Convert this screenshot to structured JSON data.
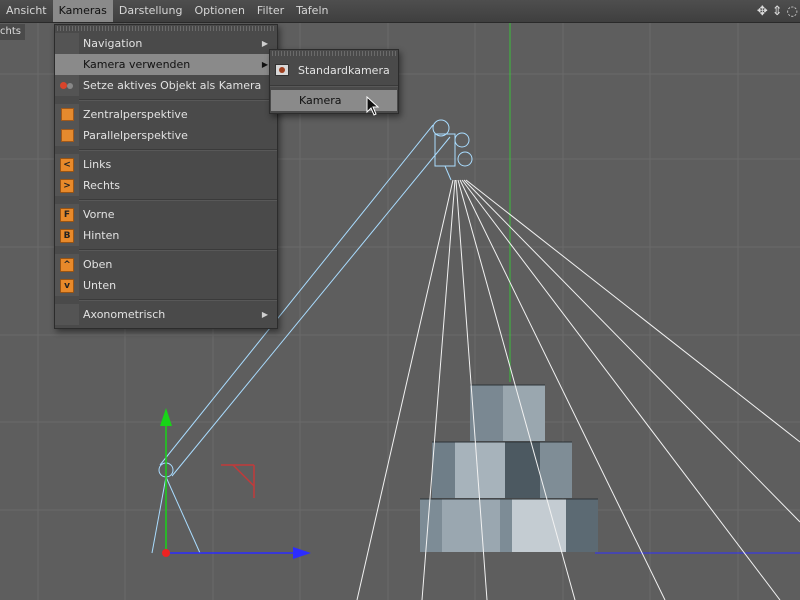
{
  "menubar": {
    "items": [
      "Ansicht",
      "Kameras",
      "Darstellung",
      "Optionen",
      "Filter",
      "Tafeln"
    ],
    "active": "Kameras",
    "tools": [
      "move-view-icon",
      "zoom-view-icon",
      "rotate-view-icon"
    ]
  },
  "viewport": {
    "view_label": "chts"
  },
  "cameras_menu": {
    "items": [
      {
        "label": "Navigation",
        "icon": "",
        "submenu": true
      },
      {
        "label": "Kamera verwenden",
        "icon": "",
        "submenu": true,
        "highlighted": true
      },
      {
        "label": "Setze aktives Objekt als Kamera",
        "icon": "set-camera-icon"
      },
      {
        "label": "Zentralperspektive",
        "icon": "perspective-cube-icon"
      },
      {
        "label": "Parallelperspektive",
        "icon": "parallel-cube-icon"
      },
      {
        "label": "Links",
        "icon": "view-left-icon",
        "glyph": "<"
      },
      {
        "label": "Rechts",
        "icon": "view-right-icon",
        "glyph": ">"
      },
      {
        "label": "Vorne",
        "icon": "view-front-icon",
        "glyph": "F"
      },
      {
        "label": "Hinten",
        "icon": "view-back-icon",
        "glyph": "B"
      },
      {
        "label": "Oben",
        "icon": "view-top-icon",
        "glyph": "^"
      },
      {
        "label": "Unten",
        "icon": "view-bottom-icon",
        "glyph": "v"
      },
      {
        "label": "Axonometrisch",
        "icon": "",
        "submenu": true
      }
    ]
  },
  "camera_submenu": {
    "items": [
      {
        "label": "Standardkamera",
        "icon": "camera-icon"
      },
      {
        "label": "Kamera",
        "icon": "",
        "highlighted": true
      }
    ]
  },
  "colors": {
    "menubar_active": "#8a8a8a",
    "menu_bg": "#4a4a4a",
    "icon_orange": "#e8892a",
    "viewport_bg": "#5e5e5e",
    "grid_line": "#6b6b6b",
    "wire_light": "#ffffff",
    "wire_camera": "#a8d8ff",
    "axis_x": "#2222ff",
    "axis_y": "#11cc11"
  }
}
